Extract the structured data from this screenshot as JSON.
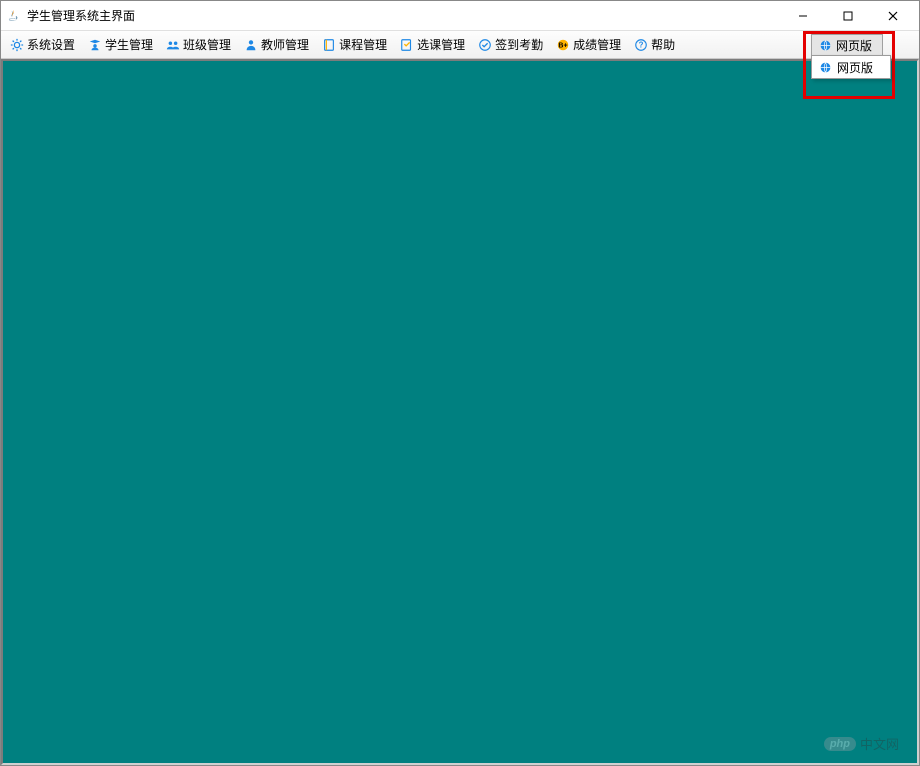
{
  "window": {
    "title": "学生管理系统主界面"
  },
  "menubar": {
    "items": [
      {
        "icon": "gear-icon",
        "label": "系统设置",
        "color": "#1e88e5"
      },
      {
        "icon": "student-icon",
        "label": "学生管理",
        "color": "#1e88e5"
      },
      {
        "icon": "group-icon",
        "label": "班级管理",
        "color": "#1e88e5"
      },
      {
        "icon": "teacher-icon",
        "label": "教师管理",
        "color": "#1e88e5"
      },
      {
        "icon": "book-icon",
        "label": "课程管理",
        "color": "#ffb300"
      },
      {
        "icon": "select-icon",
        "label": "选课管理",
        "color": "#ffb300"
      },
      {
        "icon": "check-icon",
        "label": "签到考勤",
        "color": "#1e88e5"
      },
      {
        "icon": "badge-icon",
        "label": "成绩管理",
        "color": "#ffb300"
      },
      {
        "icon": "help-icon",
        "label": "帮助",
        "color": "#1e88e5"
      }
    ],
    "web_button": {
      "label": "网页版"
    }
  },
  "dropdown": {
    "options": [
      {
        "label": "网页版"
      }
    ]
  },
  "colors": {
    "content_bg": "#008080",
    "highlight": "#e40000"
  },
  "watermark": {
    "logo": "php",
    "text": "中文网"
  }
}
